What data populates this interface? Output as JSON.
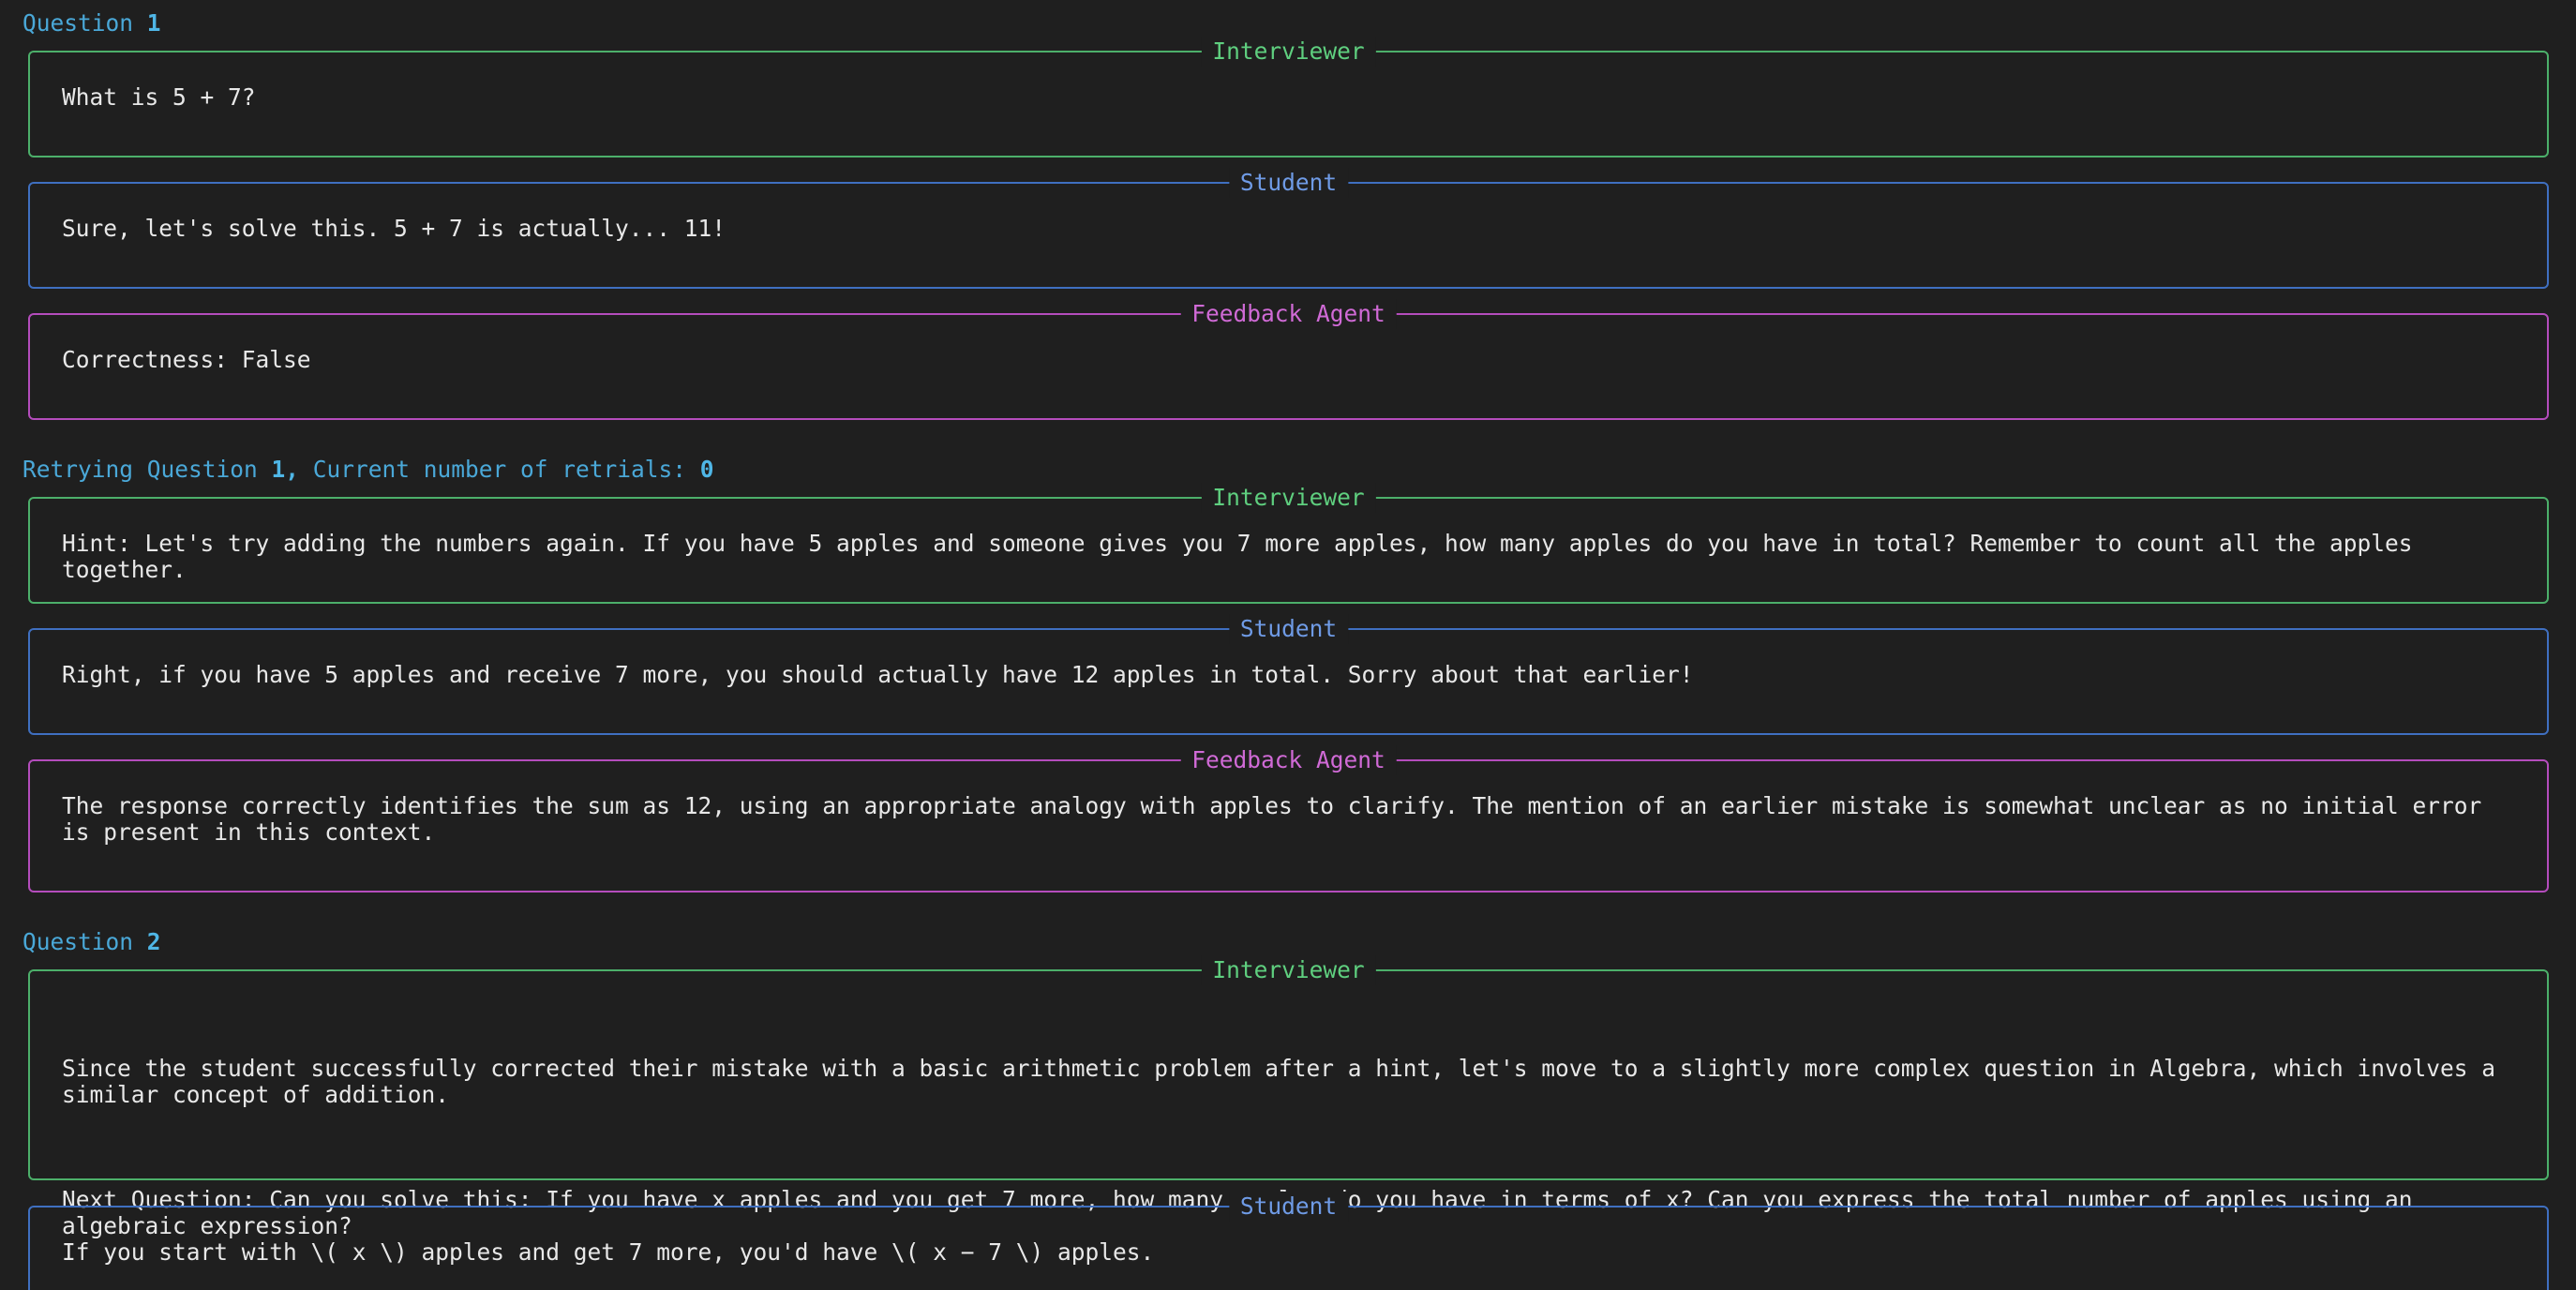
{
  "blocks": {
    "q1_heading": {
      "prefix": "Question ",
      "number": "1"
    },
    "q1_interviewer": {
      "title": "Interviewer",
      "text": "What is 5 + 7?"
    },
    "q1_student": {
      "title": "Student",
      "text": "Sure, let's solve this. 5 + 7 is actually... 11!"
    },
    "q1_feedback": {
      "title": "Feedback Agent",
      "text": "Correctness: False"
    },
    "retry_heading": {
      "prefix": "Retrying Question ",
      "number": "1,",
      "middle": " Current number of retrials: ",
      "count": "0"
    },
    "retry_interviewer": {
      "title": "Interviewer",
      "text": "Hint: Let's try adding the numbers again. If you have 5 apples and someone gives you 7 more apples, how many apples do you have in total? Remember to count all the apples together."
    },
    "retry_student": {
      "title": "Student",
      "text": "Right, if you have 5 apples and receive 7 more, you should actually have 12 apples in total. Sorry about that earlier!"
    },
    "retry_feedback": {
      "title": "Feedback Agent",
      "text": "The response correctly identifies the sum as 12, using an appropriate analogy with apples to clarify. The mention of an earlier mistake is somewhat unclear as no initial error is present in this context."
    },
    "q2_heading": {
      "prefix": "Question ",
      "number": "2"
    },
    "q2_interviewer": {
      "title": "Interviewer",
      "paragraph1": "Since the student successfully corrected their mistake with a basic arithmetic problem after a hint, let's move to a slightly more complex question in Algebra, which involves a similar concept of addition.",
      "paragraph2": "Next Question: Can you solve this: If you have x apples and you get 7 more, how many apples do you have in terms of x? Can you express the total number of apples using an algebraic expression?"
    },
    "q2_student": {
      "title": "Student",
      "text": "If you start with \\( x \\) apples and get 7 more, you'd have \\( x − 7 \\) apples."
    }
  },
  "colors": {
    "background": "#1f1f1f",
    "heading": "#4aa8d8",
    "interviewer": "#4caf6a",
    "student": "#3f6fc0",
    "feedback": "#b44cbc"
  }
}
